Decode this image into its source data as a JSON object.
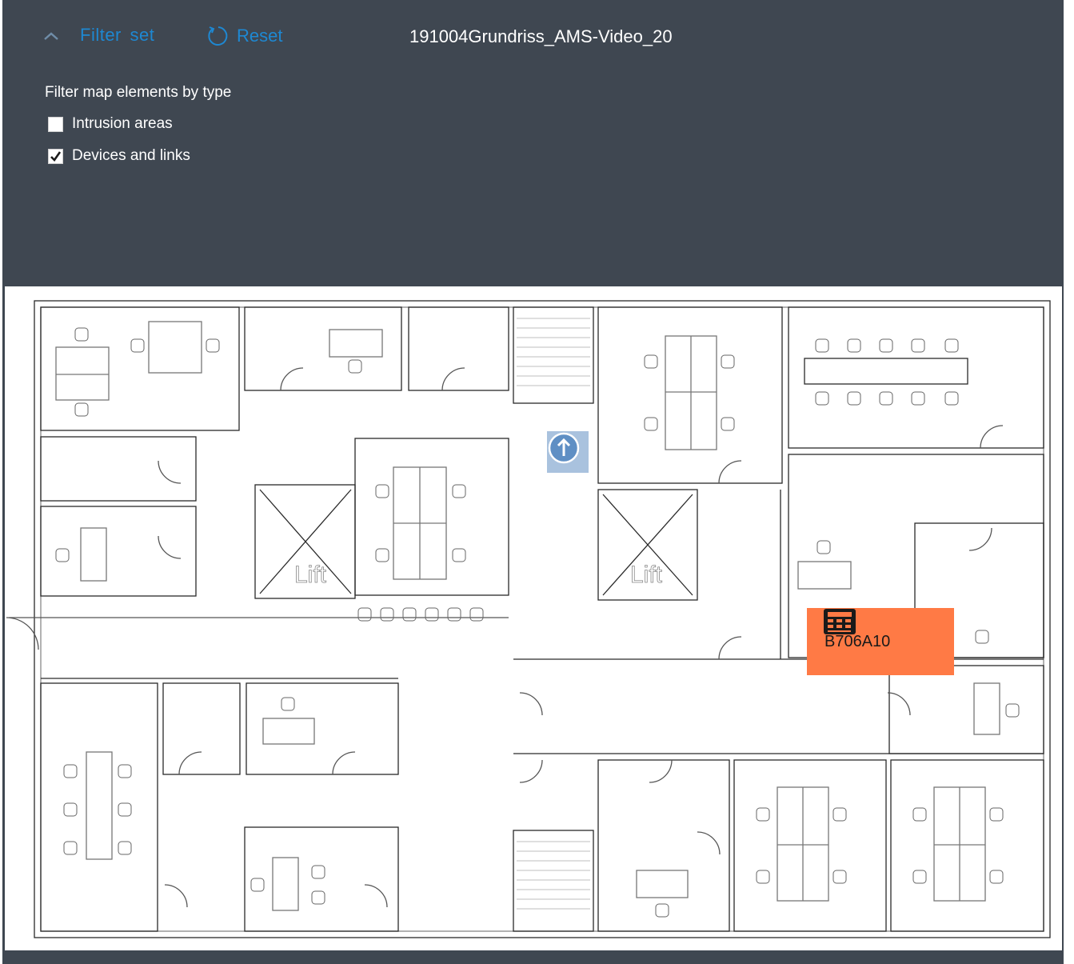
{
  "toolbar": {
    "filter_set_label": "Filter set",
    "reset_label": "Reset",
    "map_title": "191004Grundriss_AMS-Video_20"
  },
  "filter_panel": {
    "heading": "Filter map elements by type",
    "options": [
      {
        "label": "Intrusion areas",
        "checked": false
      },
      {
        "label": "Devices and links",
        "checked": true
      }
    ]
  },
  "map": {
    "lift_labels": [
      "Lift",
      "Lift"
    ],
    "device": {
      "label": "B706A10",
      "icon": "intrusion-panel-icon",
      "color": "#ff7a45"
    },
    "navigate_up_icon": "arrow-up-circle-icon"
  },
  "colors": {
    "panel_bg": "#3f4751",
    "accent": "#1e88d2",
    "device_tag": "#ff7a45",
    "up_button": "#a9c2de"
  }
}
